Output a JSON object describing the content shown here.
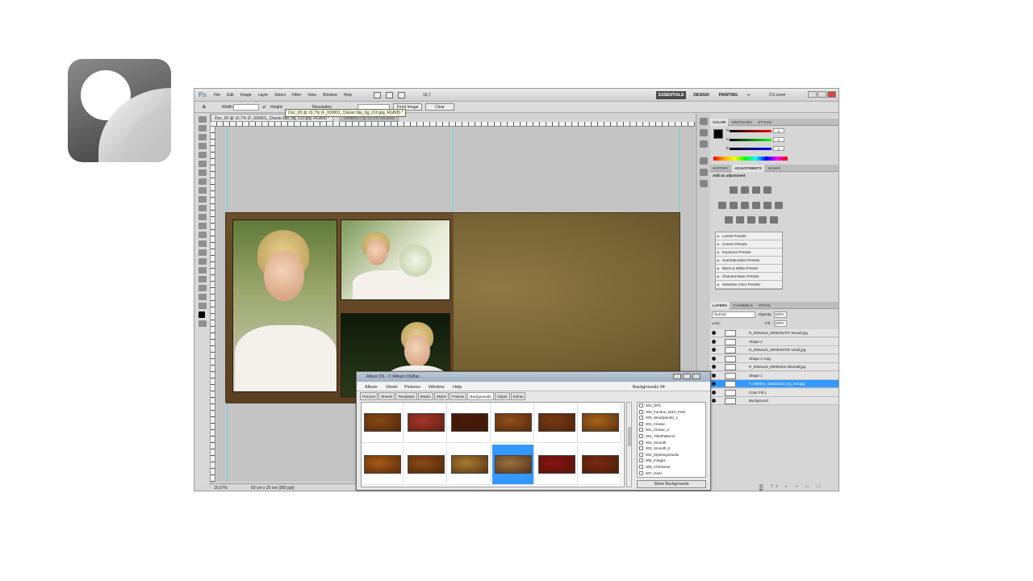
{
  "ps": {
    "logo": "Ps",
    "menus": [
      "File",
      "Edit",
      "Image",
      "Layer",
      "Select",
      "Filter",
      "View",
      "Window",
      "Help"
    ],
    "zoom": "16,7",
    "workspaces": [
      "ESSENTIALS",
      "DESIGN",
      "PAINTING",
      "»"
    ],
    "cslive": "CS Live▾",
    "options": {
      "width": "Width:",
      "height": "Height:",
      "resolution": "Resolution:",
      "front": "Front Image",
      "clear": "Clear"
    },
    "tabs": [
      "Doc_00 @ 16,7% (F_000001_Classic1bp_bg_010.jpg, RGB/8) *",
      "Untitled-1 @ 33,3% (RGB/8)"
    ],
    "tooltip": "Doc_00 @ 16,7% (F_000001_Classic1bp_bg_010.jpg, RGB/8) *",
    "status": {
      "zoom": "16,67%",
      "size": "60 cm x 25 cm (300 ppi)"
    }
  },
  "panels": {
    "color_tabs": [
      "COLOR",
      "SWATCHES",
      "STYLES"
    ],
    "color": {
      "r": "0",
      "g": "0",
      "b": "0",
      "r_label": "R",
      "g_label": "G",
      "b_label": "B"
    },
    "adj_tabs": [
      "HISTORY",
      "ADJUSTMENTS",
      "MASKS"
    ],
    "adj_title": "Add an adjustment",
    "presets": [
      "Levels Presets",
      "Curves Presets",
      "Exposure Presets",
      "Hue/Saturation Presets",
      "Black & White Presets",
      "Channel Mixer Presets",
      "Selective Color Presets"
    ],
    "layer_tabs": [
      "LAYERS",
      "CHANNELS",
      "PATHS"
    ],
    "blend": "Normal",
    "opacity_label": "Opacity:",
    "opacity": "100%",
    "lock_label": "Lock:",
    "fill_label": "Fill:",
    "fill": "100%",
    "layers": [
      {
        "name": "R_000stock_0000034797 5small.jpg",
        "sel": false
      },
      {
        "name": "Shape 2",
        "sel": false
      },
      {
        "name": "R_000stock_0000034797 small.jpg",
        "sel": false
      },
      {
        "name": "Shape 2 copy",
        "sel": false
      },
      {
        "name": "R_000stock_00000316 08small.jpg",
        "sel": false
      },
      {
        "name": "Shape 1",
        "sel": false
      },
      {
        "name": "F_000001_Classic1bp_bg_010.jpg",
        "sel": true
      },
      {
        "name": "Color Fill 1",
        "sel": false
      },
      {
        "name": "Background",
        "sel": false
      }
    ]
  },
  "album": {
    "title": "Album DS - C:\\Album DS\\Bac...",
    "menus": [
      "Album",
      "Sheet",
      "Pictures",
      "Window",
      "Help"
    ],
    "count": "Backgrounds 34",
    "tabs": [
      "Pictures",
      "Sheets",
      "Templates",
      "Masks",
      "Styles",
      "Frames",
      "Backgrounds",
      "Clipart",
      "Extras"
    ],
    "active_tab": "Backgrounds",
    "swatches": [
      "#8a4a14",
      "#a8362a",
      "#4a1a08",
      "#93501a",
      "#7a3a12",
      "#a8651a",
      "#a85a14",
      "#8a4a14",
      "#a87a30",
      "#9a7040",
      "#8a1010",
      "#7a2a10"
    ],
    "selected_swatch": 9,
    "folders": [
      {
        "name": "000_DPC",
        "checked": false
      },
      {
        "name": "000_Fondos_2010_PSD",
        "checked": false
      },
      {
        "name": "000_Woodyworld_1",
        "checked": false
      },
      {
        "name": "001_Classic",
        "checked": true
      },
      {
        "name": "001_Classic_II",
        "checked": false
      },
      {
        "name": "002_TiledPatterns",
        "checked": false
      },
      {
        "name": "003_Smooth",
        "checked": false
      },
      {
        "name": "003_Smooth_II",
        "checked": false
      },
      {
        "name": "004_Mydesignstudio",
        "checked": false
      },
      {
        "name": "005_Images",
        "checked": false
      },
      {
        "name": "006_Christmas",
        "checked": false
      },
      {
        "name": "007_Hard",
        "checked": false
      }
    ],
    "show_button": "Show Backgrounds"
  }
}
